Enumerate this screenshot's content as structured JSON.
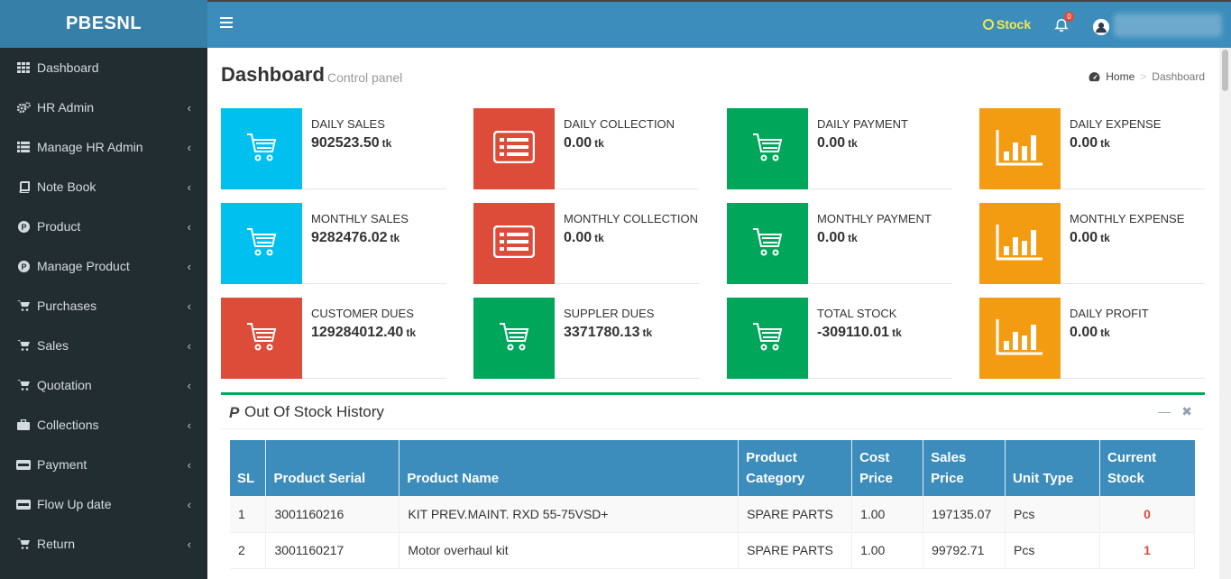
{
  "app": {
    "brand": "PBESNL"
  },
  "colors": {
    "aqua": "#00c0ef",
    "red": "#dd4b39",
    "green": "#00a65a",
    "yellow": "#f39c12",
    "header": "#3c8dbc",
    "sidebar": "#222d32"
  },
  "sidebar": {
    "items": [
      {
        "label": "Dashboard",
        "icon": "th-icon"
      },
      {
        "label": "HR Admin",
        "icon": "cogs-icon"
      },
      {
        "label": "Manage HR Admin",
        "icon": "list-icon"
      },
      {
        "label": "Note Book",
        "icon": "book-icon"
      },
      {
        "label": "Product",
        "icon": "product-p-icon"
      },
      {
        "label": "Manage Product",
        "icon": "product-p-icon"
      },
      {
        "label": "Purchases",
        "icon": "cart-icon"
      },
      {
        "label": "Sales",
        "icon": "cart-icon"
      },
      {
        "label": "Quotation",
        "icon": "cart-icon"
      },
      {
        "label": "Collections",
        "icon": "briefcase-icon"
      },
      {
        "label": "Payment",
        "icon": "paypal-icon"
      },
      {
        "label": "Flow Up date",
        "icon": "paypal-icon"
      },
      {
        "label": "Return",
        "icon": "cart-icon"
      }
    ]
  },
  "header": {
    "stock_label": "Stock",
    "notification_count": "0"
  },
  "page": {
    "title": "Dashboard",
    "subtitle": "Control panel",
    "breadcrumb": {
      "home": "Home",
      "current": "Dashboard"
    }
  },
  "stats": [
    {
      "label": "DAILY SALES",
      "value": "902523.50",
      "unit": "tk",
      "color": "aqua",
      "icon": "cart-icon"
    },
    {
      "label": "DAILY COLLECTION",
      "value": "0.00",
      "unit": "tk",
      "color": "red",
      "icon": "list-alt-icon"
    },
    {
      "label": "DAILY PAYMENT",
      "value": "0.00",
      "unit": "tk",
      "color": "green",
      "icon": "cart-icon"
    },
    {
      "label": "DAILY EXPENSE",
      "value": "0.00",
      "unit": "tk",
      "color": "yellow",
      "icon": "bar-chart-icon"
    },
    {
      "label": "MONTHLY SALES",
      "value": "9282476.02",
      "unit": "tk",
      "color": "aqua",
      "icon": "cart-icon"
    },
    {
      "label": "MONTHLY COLLECTION",
      "value": "0.00",
      "unit": "tk",
      "color": "red",
      "icon": "list-alt-icon"
    },
    {
      "label": "MONTHLY PAYMENT",
      "value": "0.00",
      "unit": "tk",
      "color": "green",
      "icon": "cart-icon"
    },
    {
      "label": "MONTHLY EXPENSE",
      "value": "0.00",
      "unit": "tk",
      "color": "yellow",
      "icon": "bar-chart-icon"
    },
    {
      "label": "CUSTOMER DUES",
      "value": "129284012.40",
      "unit": "tk",
      "color": "red",
      "icon": "cart-icon"
    },
    {
      "label": "SUPPLER DUES",
      "value": "3371780.13",
      "unit": "tk",
      "color": "green",
      "icon": "cart-icon"
    },
    {
      "label": "TOTAL STOCK",
      "value": "-309110.01",
      "unit": "tk",
      "color": "green",
      "icon": "cart-icon"
    },
    {
      "label": "DAILY PROFIT",
      "value": "0.00",
      "unit": "tk",
      "color": "yellow",
      "icon": "bar-chart-icon"
    }
  ],
  "out_of_stock": {
    "title": "Out Of Stock History",
    "columns": [
      "SL",
      "Product Serial",
      "Product Name",
      "Product Category",
      "Cost Price",
      "Sales Price",
      "Unit Type",
      "Current Stock"
    ],
    "rows": [
      [
        "1",
        "3001160216",
        "KIT PREV.MAINT. RXD 55-75VSD+",
        "SPARE PARTS",
        "1.00",
        "197135.07",
        "Pcs",
        "0"
      ],
      [
        "2",
        "3001160217",
        "Motor overhaul kit",
        "SPARE PARTS",
        "1.00",
        "99792.71",
        "Pcs",
        "1"
      ]
    ]
  }
}
